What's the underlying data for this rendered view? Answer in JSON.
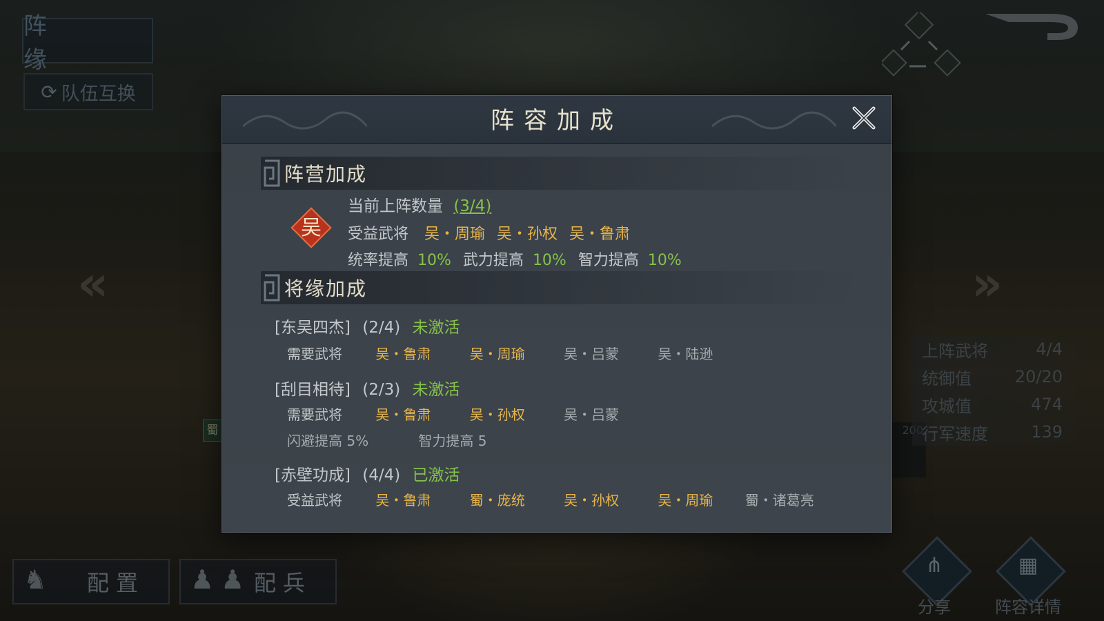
{
  "background": {
    "title": "阵 缘",
    "swap_team": "队伍互换",
    "left_arrow": "«",
    "right_arrow": "»",
    "stats": [
      {
        "label": "上阵武将",
        "value": "4/4"
      },
      {
        "label": "统御值",
        "value": "20/20"
      },
      {
        "label": "攻城值",
        "value": "474"
      },
      {
        "label": "行军速度",
        "value": "139"
      }
    ],
    "bottom_buttons": {
      "config": "配置",
      "troops": "配兵"
    },
    "share": "分享",
    "lineup_detail": "阵容详情",
    "side_troop_tag": "蜀",
    "side_counter": "200"
  },
  "modal": {
    "title": "阵容加成",
    "faction_section": {
      "heading": "阵营加成",
      "emblem": "吴",
      "count_label": "当前上阵数量",
      "count_value": "(3/4)",
      "beneficiary_label": "受益武将",
      "beneficiaries": [
        "吴・周瑜",
        "吴・孙权",
        "吴・鲁肃"
      ],
      "bonuses": [
        {
          "label": "统率提高",
          "value": "10%"
        },
        {
          "label": "武力提高",
          "value": "10%"
        },
        {
          "label": "智力提高",
          "value": "10%"
        }
      ]
    },
    "bond_section": {
      "heading": "将缘加成",
      "bonds": [
        {
          "name": "[东吴四杰]",
          "progress": "(2/4)",
          "status": "未激活",
          "generals_label": "需要武将",
          "generals": [
            {
              "name": "吴・鲁肃",
              "owned": true
            },
            {
              "name": "吴・周瑜",
              "owned": true
            },
            {
              "name": "吴・吕蒙",
              "owned": false
            },
            {
              "name": "吴・陆逊",
              "owned": false
            }
          ],
          "effects": []
        },
        {
          "name": "[刮目相待]",
          "progress": "(2/3)",
          "status": "未激活",
          "generals_label": "需要武将",
          "generals": [
            {
              "name": "吴・鲁肃",
              "owned": true
            },
            {
              "name": "吴・孙权",
              "owned": true
            },
            {
              "name": "吴・吕蒙",
              "owned": false
            }
          ],
          "effects": [
            "闪避提高 5%",
            "智力提高 5"
          ]
        },
        {
          "name": "[赤壁功成]",
          "progress": "(4/4)",
          "status": "已激活",
          "generals_label": "受益武将",
          "generals": [
            {
              "name": "吴・鲁肃",
              "owned": true
            },
            {
              "name": "蜀・庞统",
              "owned": true
            },
            {
              "name": "吴・孙权",
              "owned": true
            },
            {
              "name": "吴・周瑜",
              "owned": true
            },
            {
              "name": "蜀・诸葛亮",
              "owned": false
            }
          ],
          "effects": []
        }
      ]
    }
  },
  "colors": {
    "gold": "#e8b54a",
    "green": "#86c24a",
    "gray": "#c4c7ca",
    "wu_red": "#b8321c"
  }
}
